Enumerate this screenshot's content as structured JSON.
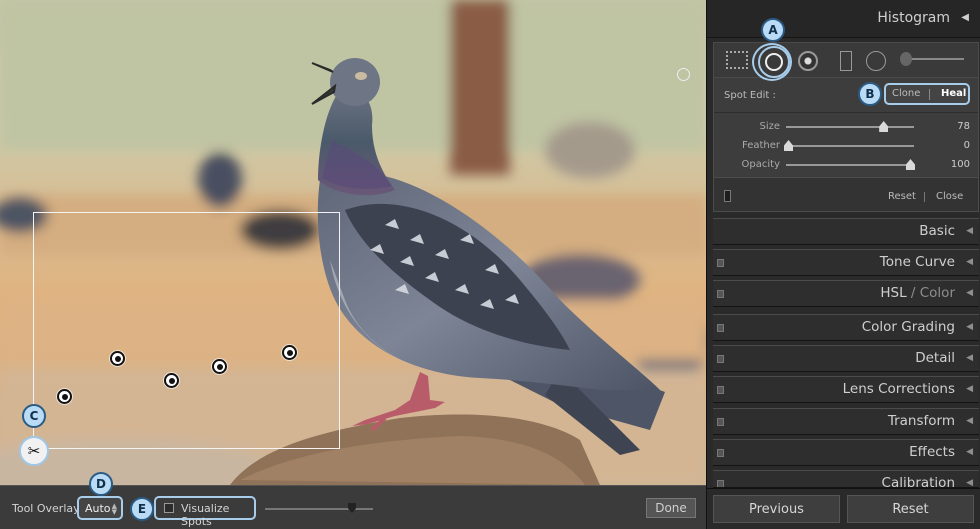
{
  "photo": {
    "scissors_icon": "✂"
  },
  "callouts": {
    "a": "A",
    "b": "B",
    "c": "C",
    "d": "D",
    "e": "E"
  },
  "toolbar": {
    "tool_overlay_label": "Tool Overlay",
    "tool_overlay_value": "Auto",
    "visualize_spots_label": "Visualize Spots",
    "done_label": "Done"
  },
  "panel": {
    "histogram_title": "Histogram",
    "spot_edit_label": "Spot Edit :",
    "clone_label": "Clone",
    "heal_label": "Heal",
    "sliders": [
      {
        "label": "Size",
        "value": "78",
        "fraction": 0.78
      },
      {
        "label": "Feather",
        "value": "0",
        "fraction": 0.0
      },
      {
        "label": "Opacity",
        "value": "100",
        "fraction": 1.0
      }
    ],
    "reset_label": "Reset",
    "close_label": "Close",
    "sections": {
      "basic": "Basic",
      "tone_curve": "Tone Curve",
      "hsl_a": "HSL",
      "hsl_slash": "/",
      "hsl_b": "Color",
      "color_grading": "Color Grading",
      "detail": "Detail",
      "lens_corrections": "Lens Corrections",
      "transform": "Transform",
      "effects": "Effects",
      "calibration": "Calibration"
    },
    "previous_label": "Previous",
    "reset_all_label": "Reset"
  }
}
